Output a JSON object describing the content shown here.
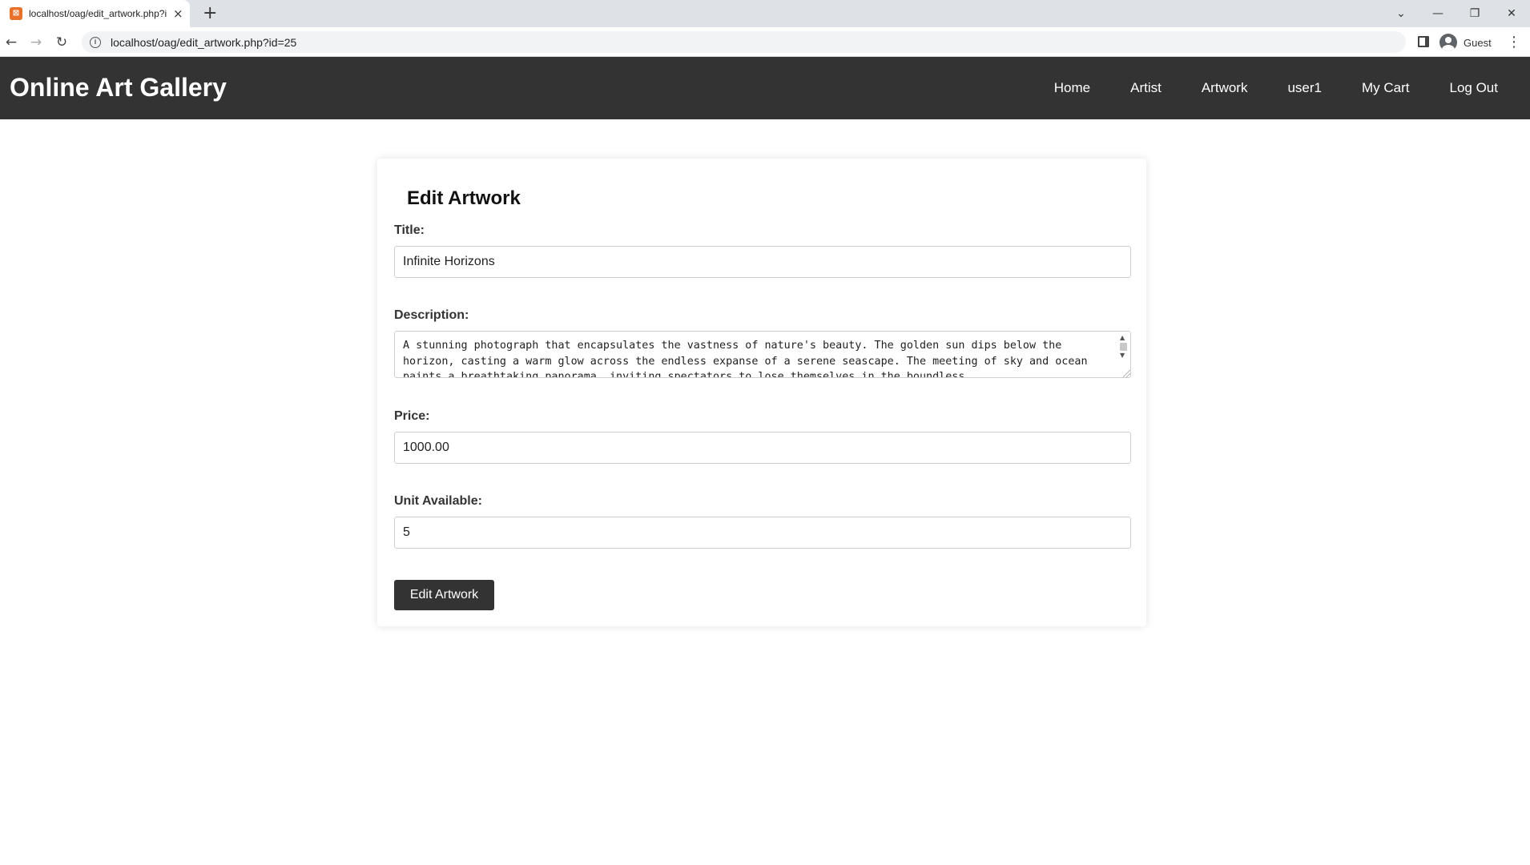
{
  "browser": {
    "tab_title": "localhost/oag/edit_artwork.php?id=25",
    "favicon_glyph": "⊠",
    "new_tab_glyph": "+",
    "url": "localhost/oag/edit_artwork.php?id=25",
    "profile_label": "Guest"
  },
  "site": {
    "logo": "Online Art Gallery",
    "nav": [
      "Home",
      "Artist",
      "Artwork",
      "user1",
      "My Cart",
      "Log Out"
    ]
  },
  "form": {
    "heading": "Edit Artwork",
    "title_label": "Title:",
    "title_value": "Infinite Horizons",
    "description_label": "Description:",
    "description_value": "A stunning photograph that encapsulates the vastness of nature's beauty. The golden sun dips below the horizon, casting a warm glow across the endless expanse of a serene seascape. The meeting of sky and ocean paints a breathtaking panorama, inviting spectators to lose themselves in the boundless",
    "price_label": "Price:",
    "price_value": "1000.00",
    "units_label": "Unit Available:",
    "units_value": "5",
    "submit_label": "Edit Artwork"
  },
  "colors": {
    "header_bg": "#333333",
    "button_bg": "#333333",
    "tabstrip_bg": "#dee1e6"
  }
}
